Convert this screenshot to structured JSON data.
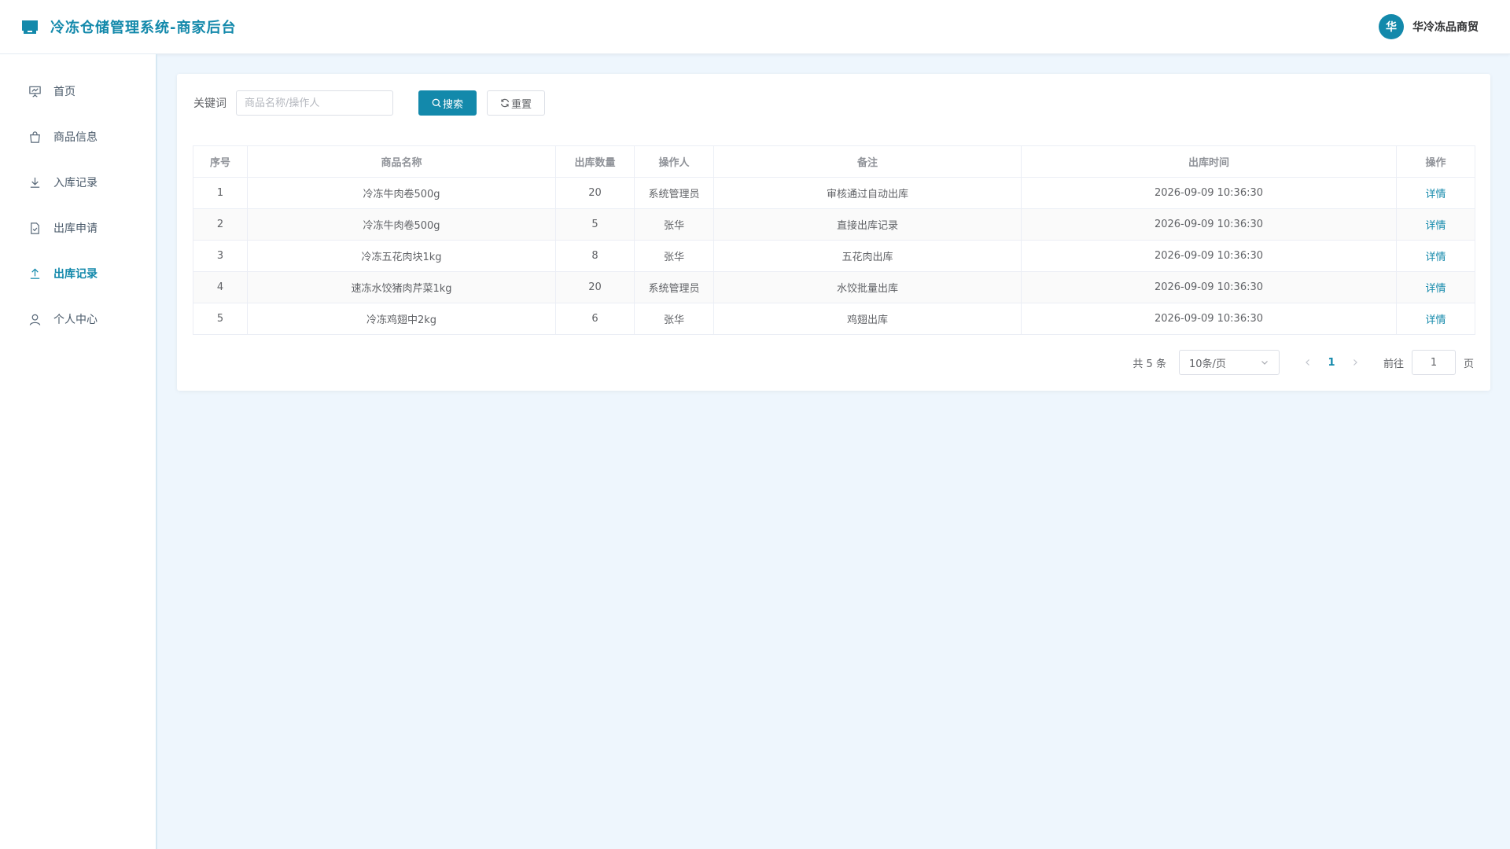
{
  "header": {
    "title": "冷冻仓储管理系统-商家后台",
    "user_avatar": "华",
    "user_name": "华冷冻品商贸",
    "brand_color": "#1389ab"
  },
  "sidebar": {
    "items": [
      {
        "label": "首页",
        "icon": "presentation-icon",
        "active": false
      },
      {
        "label": "商品信息",
        "icon": "shopping-bag-icon",
        "active": false
      },
      {
        "label": "入库记录",
        "icon": "download-icon",
        "active": false
      },
      {
        "label": "出库申请",
        "icon": "document-check-icon",
        "active": false
      },
      {
        "label": "出库记录",
        "icon": "upload-icon",
        "active": true
      },
      {
        "label": "个人中心",
        "icon": "user-icon",
        "active": false
      }
    ]
  },
  "search": {
    "label": "关键词",
    "placeholder": "商品名称/操作人",
    "value": "",
    "search_button": "搜索",
    "reset_button": "重置"
  },
  "table": {
    "columns": [
      "序号",
      "商品名称",
      "出库数量",
      "操作人",
      "备注",
      "出库时间",
      "操作"
    ],
    "rows": [
      {
        "index": "1",
        "name": "冷冻牛肉卷500g",
        "qty": "20",
        "operator": "系统管理员",
        "remark": "审核通过自动出库",
        "time": "2026-09-09 10:36:30",
        "action": "详情"
      },
      {
        "index": "2",
        "name": "冷冻牛肉卷500g",
        "qty": "5",
        "operator": "张华",
        "remark": "直接出库记录",
        "time": "2026-09-09 10:36:30",
        "action": "详情"
      },
      {
        "index": "3",
        "name": "冷冻五花肉块1kg",
        "qty": "8",
        "operator": "张华",
        "remark": "五花肉出库",
        "time": "2026-09-09 10:36:30",
        "action": "详情"
      },
      {
        "index": "4",
        "name": "速冻水饺猪肉芹菜1kg",
        "qty": "20",
        "operator": "系统管理员",
        "remark": "水饺批量出库",
        "time": "2026-09-09 10:36:30",
        "action": "详情"
      },
      {
        "index": "5",
        "name": "冷冻鸡翅中2kg",
        "qty": "6",
        "operator": "张华",
        "remark": "鸡翅出库",
        "time": "2026-09-09 10:36:30",
        "action": "详情"
      }
    ]
  },
  "pagination": {
    "total_text": "共 5 条",
    "page_size": "10条/页",
    "current_page": "1",
    "goto_label": "前往",
    "goto_value": "1",
    "goto_unit": "页"
  }
}
